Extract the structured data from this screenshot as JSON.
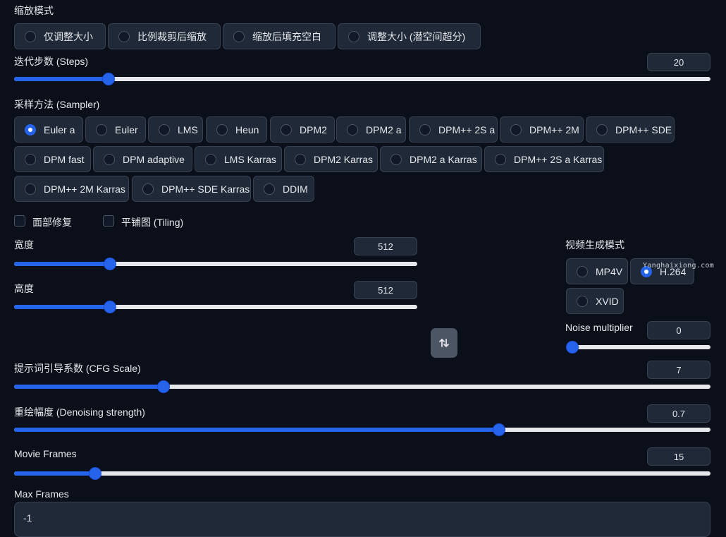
{
  "resize_mode": {
    "label": "缩放模式",
    "options": [
      "仅调整大小",
      "比例裁剪后缩放",
      "缩放后填充空白",
      "调整大小 (潜空间超分)"
    ]
  },
  "steps": {
    "label": "迭代步数 (Steps)",
    "value": "20",
    "fraction": 0.13
  },
  "sampler": {
    "label": "采样方法 (Sampler)",
    "selected": "Euler a",
    "rows": [
      [
        "Euler a",
        "Euler",
        "LMS",
        "Heun",
        "DPM2",
        "DPM2 a",
        "DPM++ 2S a",
        "DPM++ 2M",
        "DPM++ SDE"
      ],
      [
        "DPM fast",
        "DPM adaptive",
        "LMS Karras",
        "DPM2 Karras",
        "DPM2 a Karras",
        "DPM++ 2S a Karras"
      ],
      [
        "DPM++ 2M Karras",
        "DPM++ SDE Karras",
        "DDIM"
      ]
    ]
  },
  "checkboxes": {
    "face_restore": "面部修复",
    "tiling": "平铺图 (Tiling)"
  },
  "width": {
    "label": "宽度",
    "value": "512",
    "fraction": 0.23
  },
  "height": {
    "label": "高度",
    "value": "512",
    "fraction": 0.23
  },
  "swap_icon": "swap-vertical-icon",
  "video_mode": {
    "label": "视频生成模式",
    "options": [
      "MP4V",
      "H.264",
      "XVID"
    ],
    "selected": "H.264",
    "watermark": "Yanghaixiong.com"
  },
  "noise": {
    "label": "Noise multiplier",
    "value": "0",
    "fraction": 0.0
  },
  "cfg": {
    "label": "提示词引导系数 (CFG Scale)",
    "value": "7",
    "fraction": 0.21
  },
  "denoise": {
    "label": "重绘幅度 (Denoising strength)",
    "value": "0.7",
    "fraction": 0.7
  },
  "movie_frames": {
    "label": "Movie Frames",
    "value": "15",
    "fraction": 0.11
  },
  "max_frames": {
    "label": "Max Frames",
    "value": "-1"
  },
  "colors": {
    "accent": "#2563eb",
    "background": "#0b0f19",
    "control": "#1f2937"
  }
}
